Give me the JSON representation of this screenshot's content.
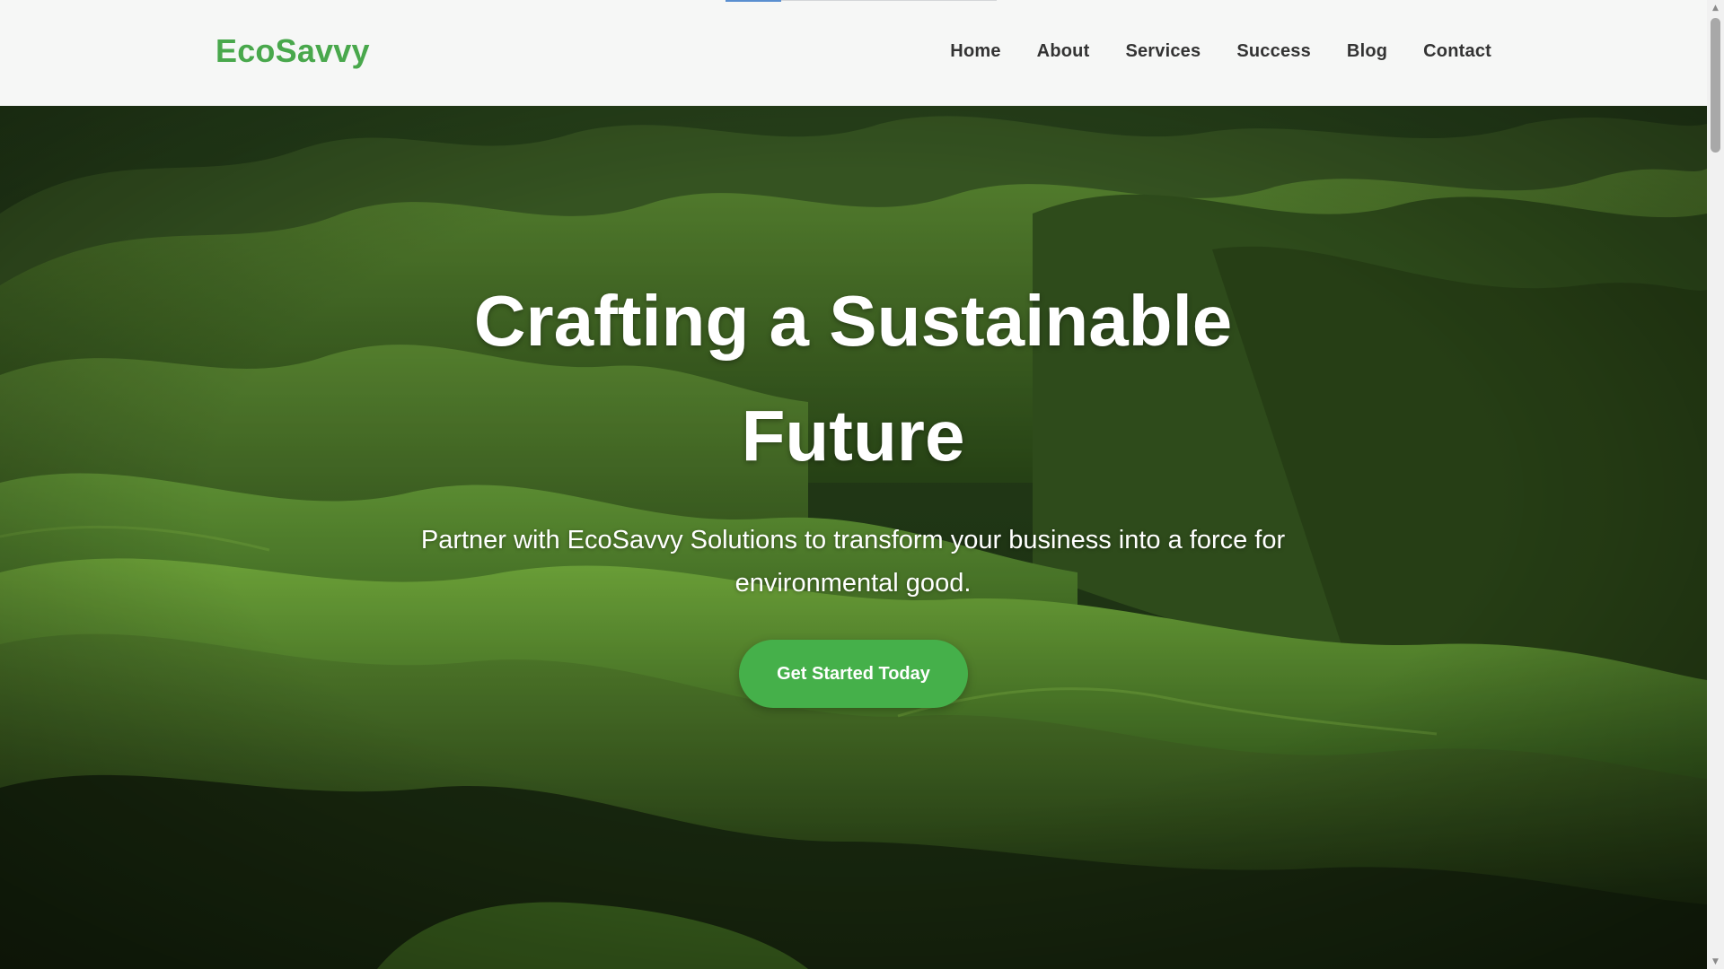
{
  "header": {
    "logo": "EcoSavvy",
    "nav": [
      {
        "label": "Home"
      },
      {
        "label": "About"
      },
      {
        "label": "Services"
      },
      {
        "label": "Success"
      },
      {
        "label": "Blog"
      },
      {
        "label": "Contact"
      }
    ]
  },
  "hero": {
    "title": "Crafting a Sustainable Future",
    "subtitle": "Partner with EcoSavvy Solutions to transform your business into a force for environmental good.",
    "cta_label": "Get Started Today",
    "background": "green rolling hills landscape"
  },
  "colors": {
    "brand": "#49a84c",
    "button": "#45b04a",
    "nav_text": "#333333",
    "header_bg": "#f6f7f6"
  },
  "scrollbar": {
    "up_icon": "chevron-up-icon",
    "down_icon": "chevron-down-icon"
  }
}
